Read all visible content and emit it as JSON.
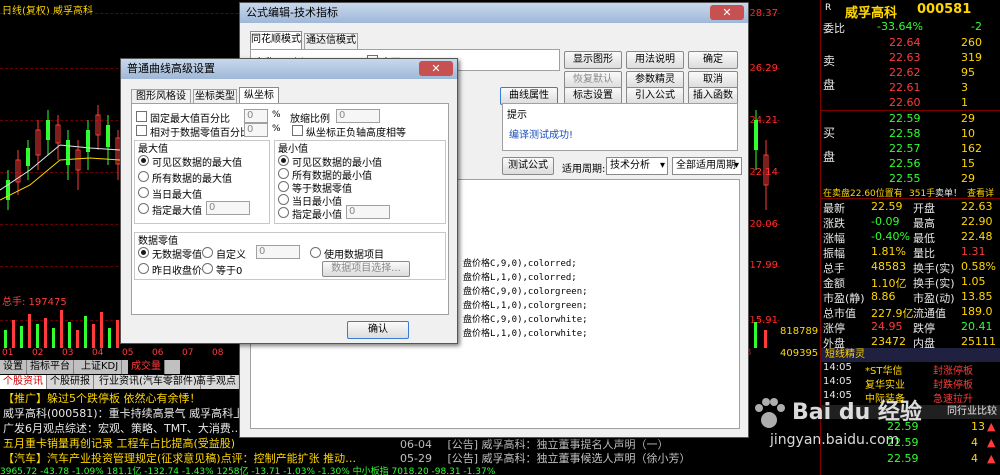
{
  "chart": {
    "stock_title": "日线(复权)  威孚高科",
    "price_labels": [
      "28.37",
      "26.29",
      "24.21",
      "22.14",
      "20.06",
      "17.99",
      "15.91"
    ],
    "turnover_label": "总手: 197475",
    "vol_labels": [
      "818789",
      "409395"
    ],
    "axis_labels": [
      "01",
      "02",
      "03",
      "04",
      "05",
      "06",
      "07",
      "08",
      "09",
      "10",
      "11",
      "12",
      "2014",
      "01",
      "02",
      "03"
    ],
    "sub_tabs": [
      "设置",
      "指标平台",
      "上证KDJ",
      "成交量"
    ],
    "news_tabs": [
      "个股资讯",
      "个股研报",
      "行业资讯(汽车零部件)",
      "高手观点"
    ],
    "news_lines": [
      "【推广】躲过5个跌停板 依然心有余悸！",
      "威孚高科(000581)：重卡持续高景气 威孚高科上",
      "广发6月观点综述：宏观、策略、TMT、大消费…",
      "五月重卡销量再创记录 工程车占比提高(受益股)",
      "【汽车】汽车产业投资管理规定(征求意见稿)点评：控制产能扩张 推动…"
    ],
    "announcements": [
      {
        "date": "06-04",
        "text": "[公告]  威孚高科：独立董事提名人声明（一）"
      },
      {
        "date": "05-29",
        "text": "[公告]  威孚高科：独立董事候选人声明（徐小芳）"
      }
    ],
    "status_bar": "3965.72  -43.78  -1.09%  181.1亿  -132.74  -1.43%  1258亿  -13.71  -1.03%  -1.30%  中小板指  7018.20  -98.31  -1.37%"
  },
  "quote": {
    "title": "威孚高科",
    "code": "000581",
    "r_badge": "R",
    "weibi_label": "委比",
    "weibi_value": "-33.64%",
    "weibi_count": "-2",
    "sell_label": "卖",
    "sell_side_label": "盘",
    "sell": [
      {
        "price": "22.64",
        "vol": "260"
      },
      {
        "price": "22.63",
        "vol": "319"
      },
      {
        "price": "22.62",
        "vol": "95"
      },
      {
        "price": "22.61",
        "vol": "3"
      },
      {
        "price": "22.60",
        "vol": "1"
      }
    ],
    "buy_label": "买",
    "buy_side_label": "盘",
    "buy": [
      {
        "price": "22.59",
        "vol": "29"
      },
      {
        "price": "22.58",
        "vol": "10"
      },
      {
        "price": "22.57",
        "vol": "162"
      },
      {
        "price": "22.56",
        "vol": "15"
      },
      {
        "price": "22.55",
        "vol": "29"
      }
    ],
    "outer_note": "在卖盘22.60位置有",
    "outer_note_vol": "351手",
    "outer_note_action": "卖单！",
    "outer_note_link": "查看详",
    "stats": [
      {
        "k1": "最新",
        "v1": "22.59",
        "k2": "开盘",
        "v2": "22.63"
      },
      {
        "k1": "涨跌",
        "v1": "-0.09",
        "k2": "最高",
        "v2": "22.90"
      },
      {
        "k1": "涨幅",
        "v1": "-0.40%",
        "k2": "最低",
        "v2": "22.48"
      },
      {
        "k1": "振幅",
        "v1": "1.81%",
        "k2": "量比",
        "v2": "1.31"
      },
      {
        "k1": "总手",
        "v1": "48583",
        "k2": "换手(实)",
        "v2": "0.58%"
      },
      {
        "k1": "金额",
        "v1": "1.10亿",
        "k2": "换手(实)",
        "v2": "1.05"
      },
      {
        "k1": "市盈(静)",
        "v1": "8.86",
        "k2": "市盈(动)",
        "v2": "13.85"
      },
      {
        "k1": "总市值",
        "v1": "227.9亿",
        "k2": "流通值",
        "v2": "189.0"
      },
      {
        "k1": "涨停",
        "v1": "24.95",
        "k2": "跌停",
        "v2": "20.41"
      },
      {
        "k1": "外盘",
        "v1": "23472",
        "k2": "内盘",
        "v2": "25111"
      }
    ],
    "elf_title": "短线精灵",
    "elf_rows": [
      {
        "time": "14:05",
        "name": "*ST华信",
        "event": "封涨停板"
      },
      {
        "time": "14:05",
        "name": "复华实业",
        "event": "封跌停板"
      },
      {
        "time": "14:05",
        "name": "中际装备",
        "event": "急速拉升"
      }
    ],
    "trade_title": "同行业比较",
    "trades": [
      {
        "price": "22.59",
        "vol": "13"
      },
      {
        "price": "22.59",
        "vol": "4"
      },
      {
        "price": "22.59",
        "vol": "4"
      }
    ]
  },
  "formula_window": {
    "title": "公式编辑-技术指标",
    "tabs": [
      "同花顺模式",
      "通达信模式"
    ],
    "name_label": "名称",
    "name_value": "上证KDJ",
    "password_label": "密码",
    "buttons_right": [
      "显示图形",
      "用法说明",
      "确定",
      "恢复默认",
      "参数精灵",
      "取消"
    ],
    "buttons_row": [
      "曲线属性",
      "标志设置",
      "引入公式",
      "插入函数"
    ],
    "hint_label": "提示",
    "hint_text": "编译测试成功!",
    "test_button": "测试公式",
    "period_label": "适用周期:",
    "period_value": "技术分析",
    "period2_value": "全部适用周期",
    "code_lines": [
      "盘价格C,9,0),colorred;",
      "盘价格L,1,0),colorred;",
      "盘价格C,9,0),colorgreen;",
      "盘价格L,1,0),colorgreen;",
      "盘价格C,9,0),colorwhite;",
      "盘价格L,1,0),colorwhite;"
    ]
  },
  "curve_window": {
    "title": "普通曲线高级设置",
    "tabs": [
      "图形风格设置",
      "坐标类型",
      "纵坐标"
    ],
    "opt_max_pct": "固定最大值百分比",
    "opt_rel_pct": "相对于数据零值百分比",
    "pct_unit": "%",
    "scale_label": "放缩比例",
    "scale_value": "0",
    "same_height_label": "纵坐标正负轴高度相等",
    "field_zero": "0",
    "max_group": "最大值",
    "max_options": [
      "可见区数据的最大值",
      "所有数据的最大值",
      "当日最大值",
      "指定最大值"
    ],
    "min_group": "最小值",
    "min_options": [
      "可见区数据的最小值",
      "所有数据的最小值",
      "等于数据零值",
      "当日最小值",
      "指定最小值"
    ],
    "zero_group": "数据零值",
    "zero_options": [
      "无数据零值",
      "自定义",
      "使用数据项目",
      "昨日收盘价",
      "等于0"
    ],
    "data_item_button": "数据项目选择...",
    "ok_button": "确认"
  },
  "watermark": {
    "brand": "Bai du 经验",
    "url": "jingyan.baidu.com"
  }
}
